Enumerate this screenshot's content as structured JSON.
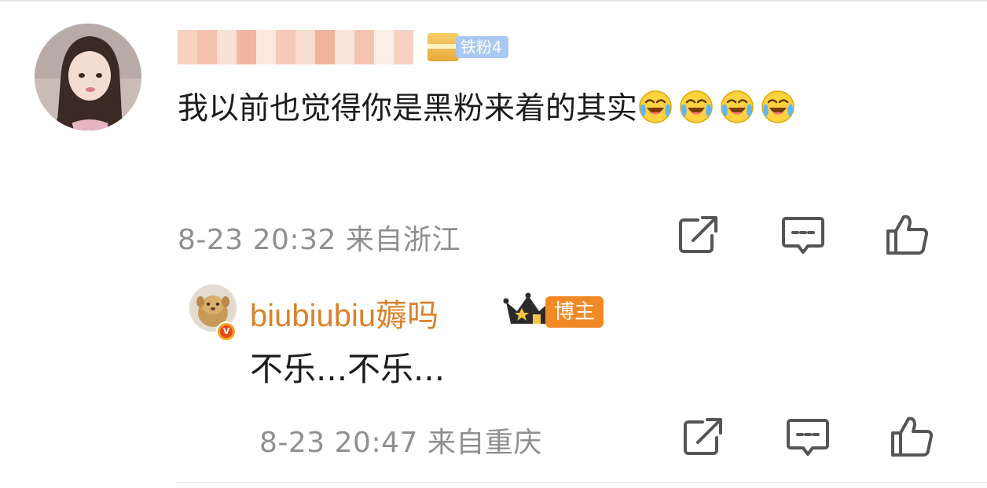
{
  "comment": {
    "text": "我以前也觉得你是黑粉来着的其实",
    "emoji_name": "laughing-tears-icon",
    "emoji_count": 4,
    "fan_badge": "铁粉4",
    "time": "8-23 20:32",
    "location": "来自浙江"
  },
  "reply": {
    "username": "biubiubiu薅吗",
    "badge": "博主",
    "crown_level": "II",
    "text": "不乐...不乐...",
    "time": "8-23 20:47",
    "location": "来自重庆"
  },
  "icons": {
    "share": "share-icon",
    "comment": "comment-icon",
    "like": "thumbs-up-icon",
    "verified": "verified-v-icon"
  },
  "colors": {
    "username_orange": "#d9822b",
    "badge_orange": "#f08a24",
    "fan_badge_blue": "#a9c8f2",
    "meta_gray": "#8f8f8f",
    "text": "#1c1c1c"
  }
}
